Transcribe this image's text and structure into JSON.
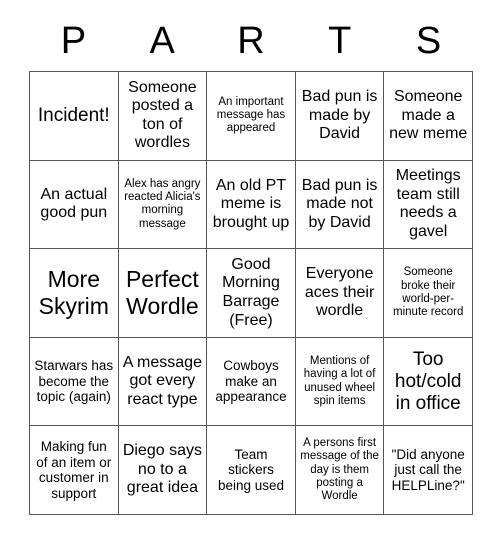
{
  "card": {
    "header_letters": [
      "P",
      "A",
      "R",
      "T",
      "S"
    ],
    "rows": [
      [
        {
          "text": "Incident!",
          "size": "lg"
        },
        {
          "text": "Someone posted a ton of wordles",
          "size": "md"
        },
        {
          "text": "An important message has appeared",
          "size": "xs"
        },
        {
          "text": "Bad pun is made by David",
          "size": "md"
        },
        {
          "text": "Someone made a new meme",
          "size": "md"
        }
      ],
      [
        {
          "text": "An actual good pun",
          "size": "md"
        },
        {
          "text": "Alex has angry reacted Alicia's morning message",
          "size": "xs"
        },
        {
          "text": "An old PT meme is brought up",
          "size": "md"
        },
        {
          "text": "Bad pun is made not by David",
          "size": "md"
        },
        {
          "text": "Meetings team still needs a gavel",
          "size": "md"
        }
      ],
      [
        {
          "text": "More Skyrim",
          "size": "xl"
        },
        {
          "text": "Perfect Wordle",
          "size": "xl"
        },
        {
          "text": "Good Morning Barrage (Free)",
          "size": "md"
        },
        {
          "text": "Everyone aces their wordle",
          "size": "md"
        },
        {
          "text": "Someone broke their world-per-minute record",
          "size": "xs"
        }
      ],
      [
        {
          "text": "Starwars has become the topic (again)",
          "size": "sm"
        },
        {
          "text": "A message got every react type",
          "size": "md"
        },
        {
          "text": "Cowboys make an appearance",
          "size": "sm"
        },
        {
          "text": "Mentions of having a lot of unused wheel spin items",
          "size": "xs"
        },
        {
          "text": "Too hot/cold in office",
          "size": "lg"
        }
      ],
      [
        {
          "text": "Making fun of an item or customer in support",
          "size": "sm"
        },
        {
          "text": "Diego says no to a great idea",
          "size": "md"
        },
        {
          "text": "Team stickers being used",
          "size": "sm"
        },
        {
          "text": "A persons first message of the day is them posting a Wordle",
          "size": "xs"
        },
        {
          "text": "\"Did anyone just call the HELPLine?\"",
          "size": "sm"
        }
      ]
    ]
  }
}
